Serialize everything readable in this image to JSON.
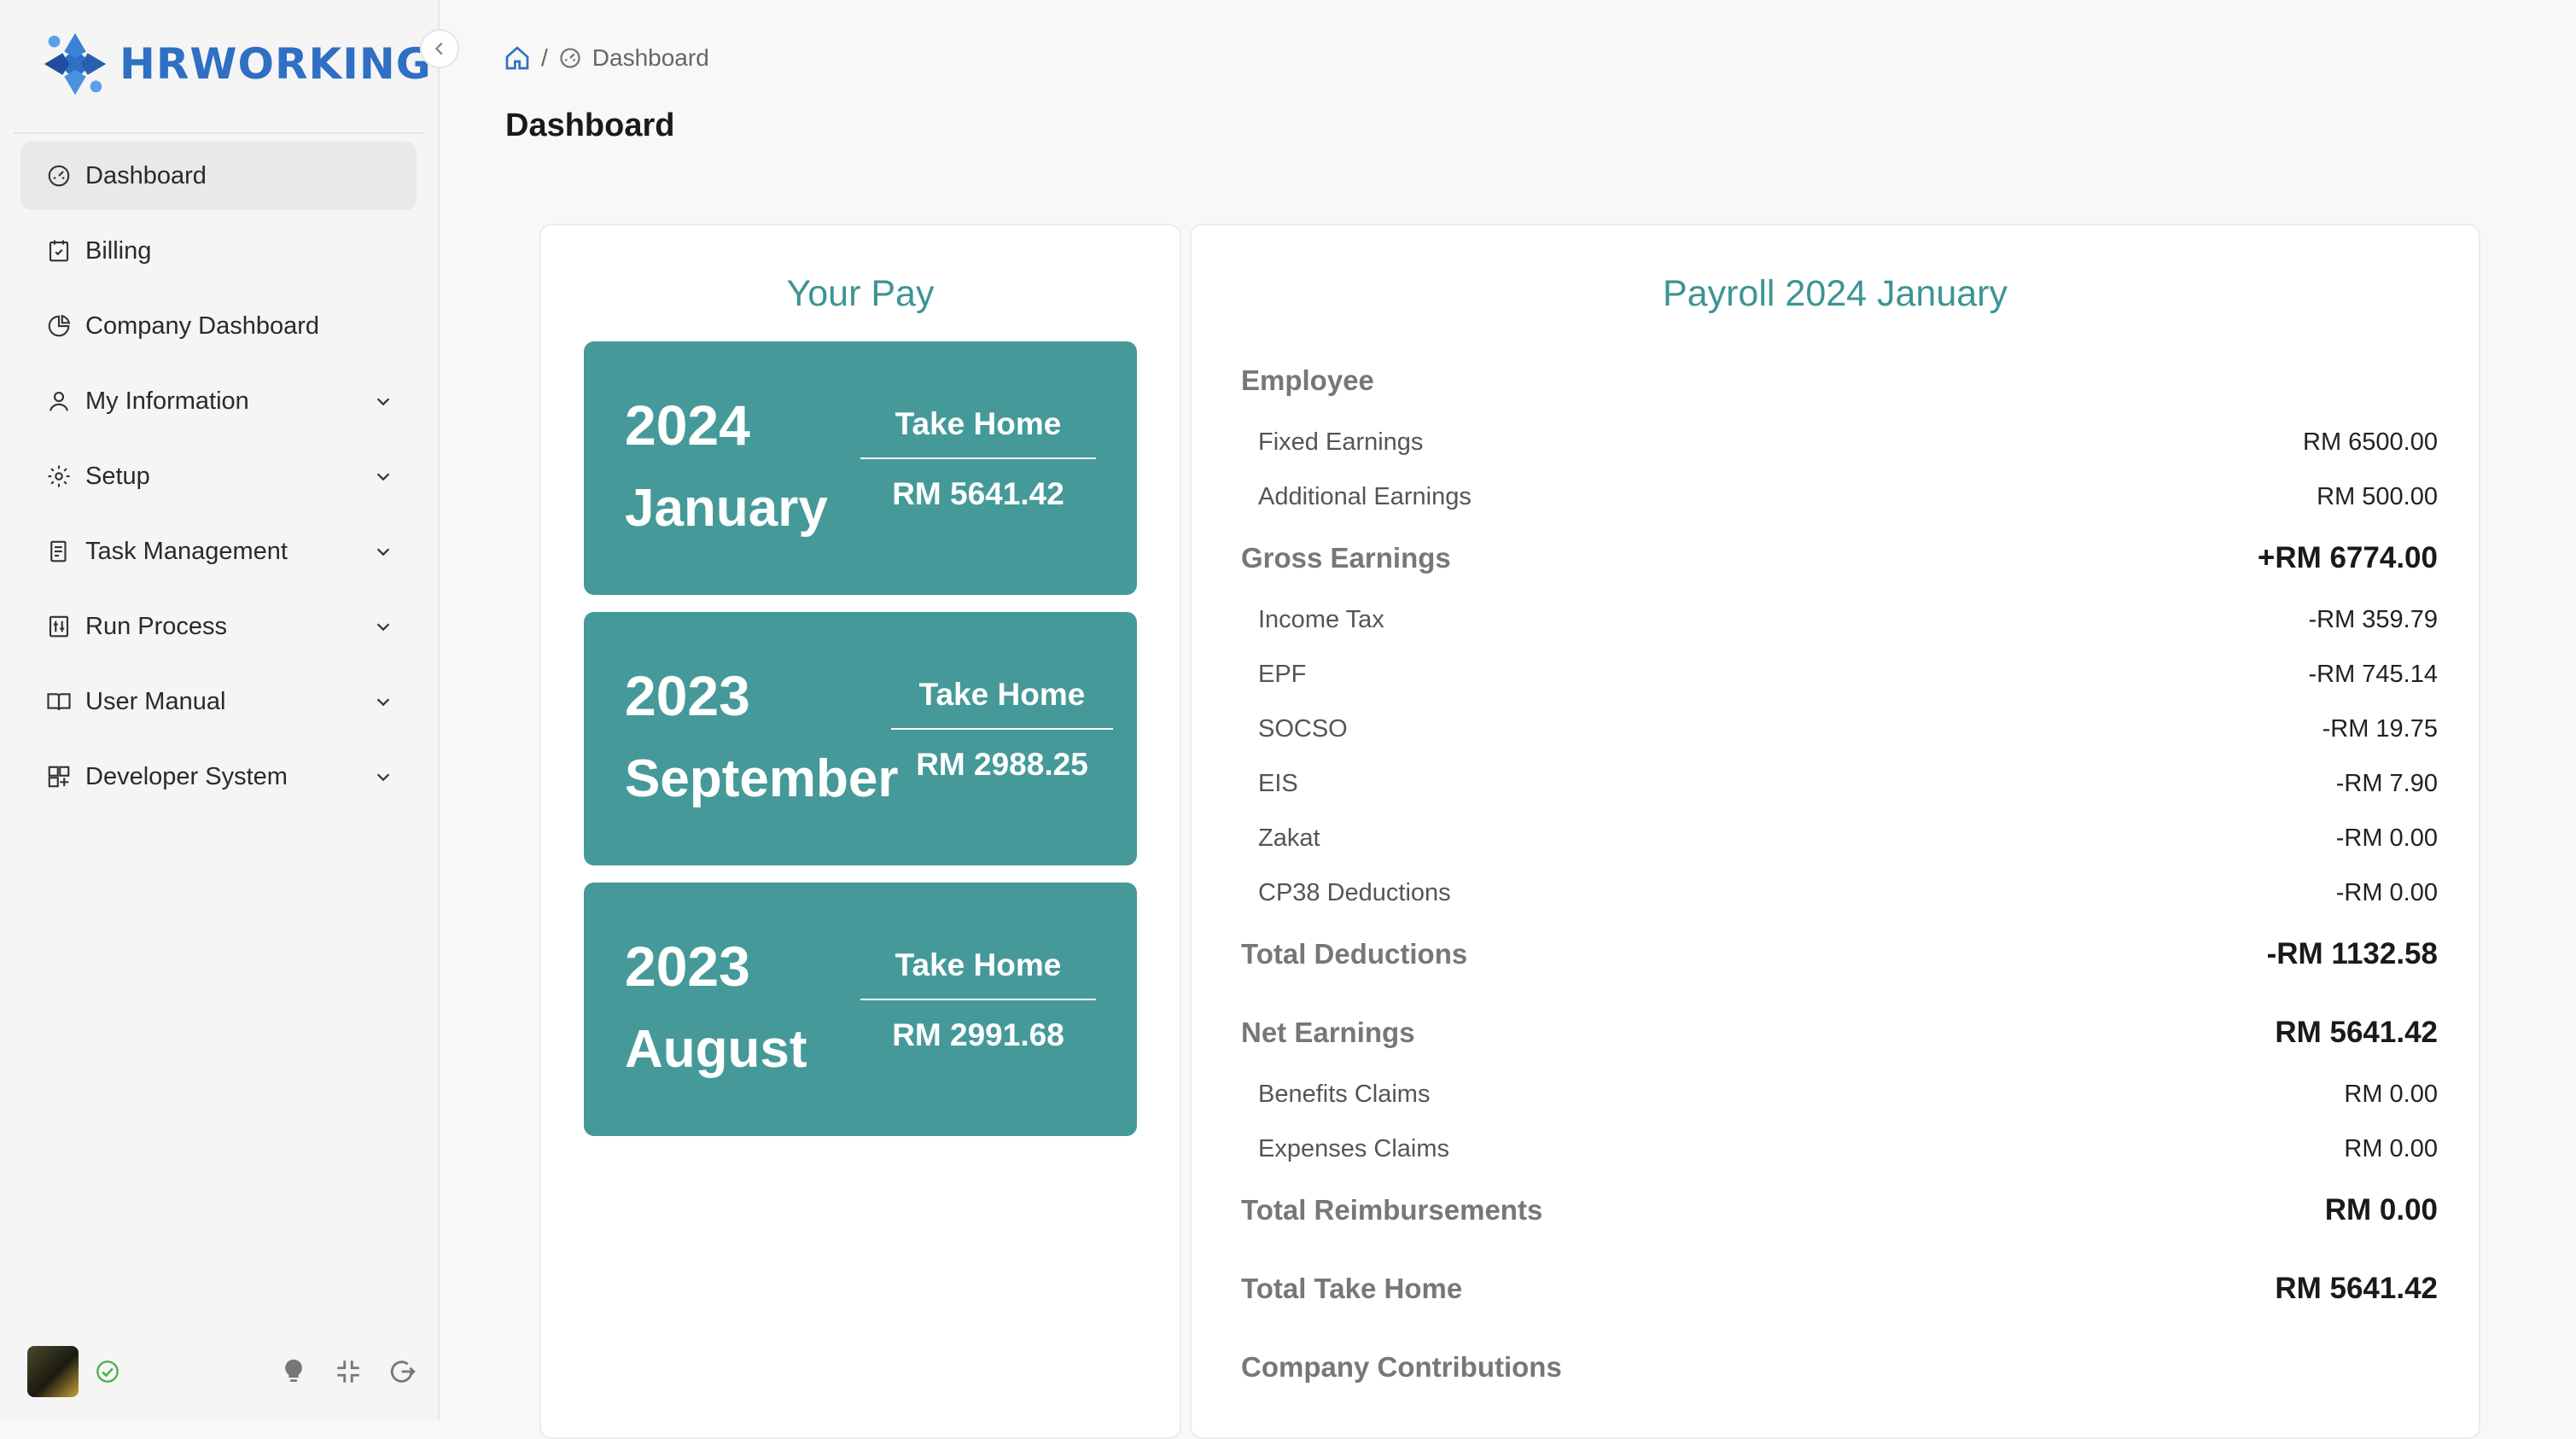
{
  "app": {
    "brand": "HRWORKING"
  },
  "sidebar": {
    "items": [
      {
        "label": "Dashboard",
        "icon": "dashboard-icon",
        "active": true,
        "expandable": false
      },
      {
        "label": "Billing",
        "icon": "billing-icon",
        "active": false,
        "expandable": false
      },
      {
        "label": "Company Dashboard",
        "icon": "pie-chart-icon",
        "active": false,
        "expandable": false
      },
      {
        "label": "My Information",
        "icon": "user-icon",
        "active": false,
        "expandable": true
      },
      {
        "label": "Setup",
        "icon": "gear-icon",
        "active": false,
        "expandable": true
      },
      {
        "label": "Task Management",
        "icon": "task-icon",
        "active": false,
        "expandable": true
      },
      {
        "label": "Run Process",
        "icon": "process-icon",
        "active": false,
        "expandable": true
      },
      {
        "label": "User Manual",
        "icon": "book-icon",
        "active": false,
        "expandable": true
      },
      {
        "label": "Developer System",
        "icon": "developer-icon",
        "active": false,
        "expandable": true
      }
    ]
  },
  "breadcrumb": {
    "current": "Dashboard"
  },
  "page": {
    "title": "Dashboard"
  },
  "your_pay": {
    "title": "Your Pay",
    "tiles": [
      {
        "year": "2024",
        "month": "January",
        "label": "Take Home",
        "amount": "RM 5641.42"
      },
      {
        "year": "2023",
        "month": "September",
        "label": "Take Home",
        "amount": "RM 2988.25"
      },
      {
        "year": "2023",
        "month": "August",
        "label": "Take Home",
        "amount": "RM 2991.68"
      }
    ]
  },
  "payroll": {
    "title": "Payroll 2024 January",
    "rows": [
      {
        "kind": "section",
        "label": "Employee",
        "value": ""
      },
      {
        "kind": "sub",
        "label": "Fixed Earnings",
        "value": "RM 6500.00"
      },
      {
        "kind": "sub",
        "label": "Additional Earnings",
        "value": "RM 500.00"
      },
      {
        "kind": "total",
        "label": "Gross Earnings",
        "value": "+RM 6774.00"
      },
      {
        "kind": "sub",
        "label": "Income Tax",
        "value": "-RM 359.79"
      },
      {
        "kind": "sub",
        "label": "EPF",
        "value": "-RM 745.14"
      },
      {
        "kind": "sub",
        "label": "SOCSO",
        "value": "-RM 19.75"
      },
      {
        "kind": "sub",
        "label": "EIS",
        "value": "-RM 7.90"
      },
      {
        "kind": "sub",
        "label": "Zakat",
        "value": "-RM 0.00"
      },
      {
        "kind": "sub",
        "label": "CP38 Deductions",
        "value": "-RM 0.00"
      },
      {
        "kind": "total",
        "label": "Total Deductions",
        "value": "-RM 1132.58"
      },
      {
        "kind": "gap"
      },
      {
        "kind": "total",
        "label": "Net Earnings",
        "value": "RM 5641.42"
      },
      {
        "kind": "sub",
        "label": "Benefits Claims",
        "value": "RM 0.00"
      },
      {
        "kind": "sub",
        "label": "Expenses Claims",
        "value": "RM 0.00"
      },
      {
        "kind": "total",
        "label": "Total Reimbursements",
        "value": "RM 0.00"
      },
      {
        "kind": "gap"
      },
      {
        "kind": "total",
        "label": "Total Take Home",
        "value": "RM 5641.42"
      },
      {
        "kind": "gap"
      },
      {
        "kind": "section",
        "label": "Company Contributions",
        "value": ""
      }
    ]
  },
  "colors": {
    "accent": "#459999",
    "title_teal": "#3d9494",
    "brand_blue": "#2f6fc4",
    "online_green": "#4caf50"
  }
}
